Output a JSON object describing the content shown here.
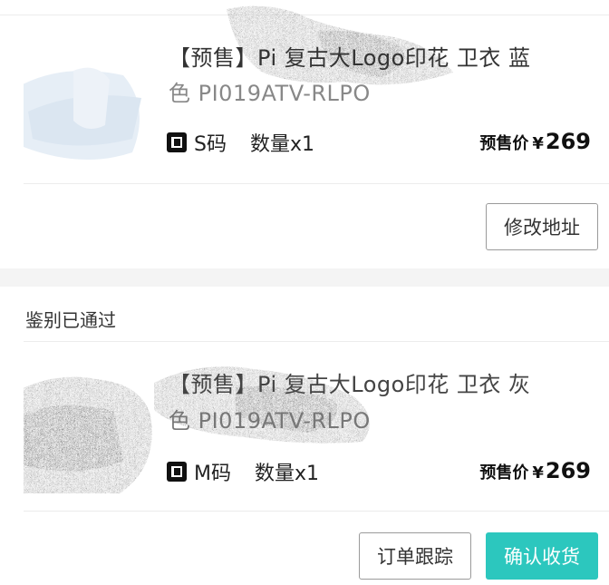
{
  "order1": {
    "title_line1": "【预售】Pi 复古大Logo印花 卫衣 蓝",
    "title_line2": "色 PI019ATV-RLPO",
    "size": "S码",
    "quantity": "数量x1",
    "price_label": "预售价",
    "currency": "¥",
    "price": "269",
    "action_button": "修改地址"
  },
  "order2": {
    "status": "鉴别已通过",
    "title_line1": "【预售】Pi 复古大Logo印花 卫衣 灰",
    "title_line2": "色 PI019ATV-RLPO",
    "size": "M码",
    "quantity": "数量x1",
    "price_label": "预售价",
    "currency": "¥",
    "price": "269",
    "track_button": "订单跟踪",
    "confirm_button": "确认收货"
  },
  "colors": {
    "accent": "#2cc7be",
    "divider": "#ececec",
    "band": "#f4f4f4"
  }
}
